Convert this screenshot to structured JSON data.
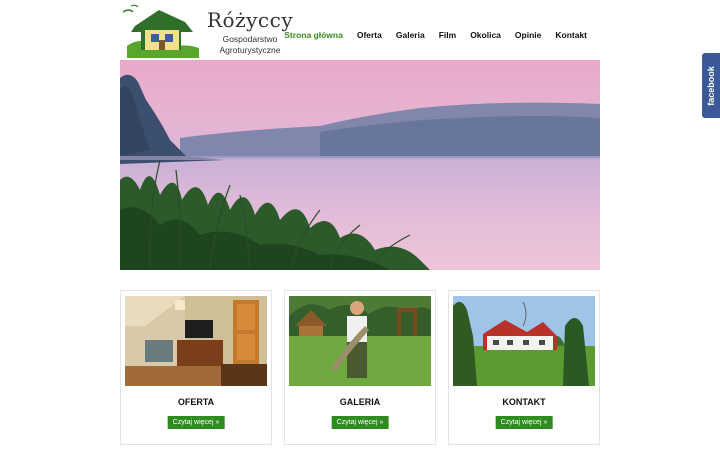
{
  "logo": {
    "title": "Różyccy",
    "subtitle_line1": "Gospodarstwo",
    "subtitle_line2": "Agroturystyczne"
  },
  "nav": {
    "items": [
      "Strona główna",
      "Oferta",
      "Galeria",
      "Film",
      "Okolica",
      "Opinie",
      "Kontakt"
    ],
    "active_index": 0
  },
  "facebook": {
    "label": "facebook"
  },
  "cards": [
    {
      "title": "OFERTA",
      "button": "Czytaj więcej »"
    },
    {
      "title": "GALERIA",
      "button": "Czytaj więcej »"
    },
    {
      "title": "KONTAKT",
      "button": "Czytaj więcej »"
    }
  ],
  "colors": {
    "accent": "#3a8a1e",
    "button": "#2e8b1e",
    "facebook": "#3b5998"
  }
}
